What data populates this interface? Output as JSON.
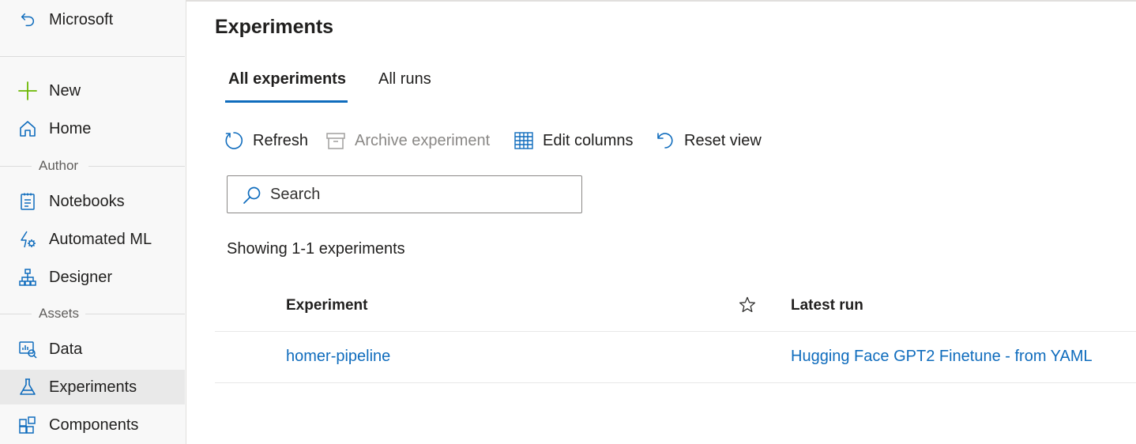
{
  "sidebar": {
    "workspace": {
      "label": "Microsoft",
      "icon": "back-arrow-icon"
    },
    "items": [
      {
        "id": "new",
        "label": "New",
        "icon": "plus-icon",
        "color": "#6bb700"
      },
      {
        "id": "home",
        "label": "Home",
        "icon": "home-icon"
      },
      {
        "id": "notebooks",
        "label": "Notebooks",
        "icon": "notebook-icon"
      },
      {
        "id": "automated-ml",
        "label": "Automated ML",
        "icon": "automl-icon"
      },
      {
        "id": "designer",
        "label": "Designer",
        "icon": "designer-icon"
      },
      {
        "id": "data",
        "label": "Data",
        "icon": "data-icon"
      },
      {
        "id": "experiments",
        "label": "Experiments",
        "icon": "flask-icon",
        "active": true
      },
      {
        "id": "components",
        "label": "Components",
        "icon": "components-icon"
      }
    ],
    "sections": {
      "author": "Author",
      "assets": "Assets"
    }
  },
  "page": {
    "title": "Experiments",
    "tabs": [
      {
        "label": "All experiments",
        "active": true
      },
      {
        "label": "All runs",
        "active": false
      }
    ],
    "toolbar": {
      "refresh": "Refresh",
      "archive": "Archive experiment",
      "edit_columns": "Edit columns",
      "reset_view": "Reset view"
    },
    "search": {
      "placeholder": "Search",
      "value": ""
    },
    "showing": "Showing 1-1 experiments",
    "table": {
      "headers": {
        "experiment": "Experiment",
        "latest_run": "Latest run"
      },
      "rows": [
        {
          "experiment": "homer-pipeline",
          "latest_run": "Hugging Face GPT2 Finetune - from YAML"
        }
      ]
    }
  },
  "colors": {
    "accent": "#0f6cbd",
    "sidebar_bg": "#f8f8f8",
    "active_bg": "#e9e9e9",
    "new_icon": "#6bb700",
    "disabled": "#8a8886"
  }
}
